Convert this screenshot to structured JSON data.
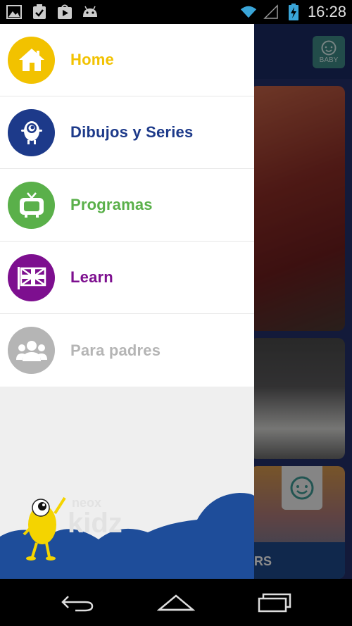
{
  "status_bar": {
    "time": "16:28",
    "icons": [
      "image-icon",
      "clipboard-check-icon",
      "play-store-icon",
      "android-icon",
      "wifi-icon",
      "signal-icon",
      "battery-charging-icon"
    ]
  },
  "background": {
    "baby_label": "BABY",
    "card3_text": "RS"
  },
  "menu": {
    "items": [
      {
        "label": "Home",
        "color": "#f2c200",
        "icon": "house-icon"
      },
      {
        "label": "Dibujos y Series",
        "color": "#1d3a8a",
        "icon": "cartoon-eye-icon"
      },
      {
        "label": "Programas",
        "color": "#5ab04a",
        "icon": "tv-icon"
      },
      {
        "label": "Learn",
        "color": "#7d0f8f",
        "icon": "uk-flag-icon"
      },
      {
        "label": "Para padres",
        "color": "#b5b5b5",
        "icon": "parents-icon"
      }
    ]
  },
  "brand": {
    "logo_top": "neox",
    "logo_bottom": "kidz",
    "wave_color": "#1e4d9a"
  },
  "nav": {
    "buttons": [
      "back-icon",
      "home-icon",
      "recents-icon"
    ]
  }
}
